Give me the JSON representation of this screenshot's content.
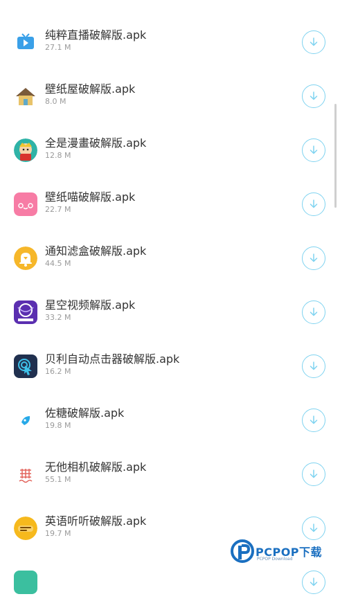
{
  "apps": [
    {
      "name": "纯粹直播破解版.apk",
      "size": "27.1 M",
      "icon": "tv-icon"
    },
    {
      "name": "壁纸屋破解版.apk",
      "size": "8.0 M",
      "icon": "house-icon"
    },
    {
      "name": "全是漫畫破解版.apk",
      "size": "12.8 M",
      "icon": "manga-icon"
    },
    {
      "name": "壁纸喵破解版.apk",
      "size": "22.7 M",
      "icon": "cat-face-icon"
    },
    {
      "name": "通知滤盒破解版.apk",
      "size": "44.5 M",
      "icon": "bell-icon"
    },
    {
      "name": "星空视频解版.apk",
      "size": "33.2 M",
      "icon": "starry-sky-icon"
    },
    {
      "name": "贝利自动点击器破解版.apk",
      "size": "16.2 M",
      "icon": "tap-icon"
    },
    {
      "name": "佐糖破解版.apk",
      "size": "19.8 M",
      "icon": "brush-icon"
    },
    {
      "name": "无他相机破解版.apk",
      "size": "55.1 M",
      "icon": "camera-grid-icon"
    },
    {
      "name": "英语听听破解版.apk",
      "size": "19.7 M",
      "icon": "english-icon"
    }
  ],
  "watermark": {
    "title": "PCPOP下载",
    "subtitle": "PCPOP Download"
  },
  "colors": {
    "accent": "#7fd3f0",
    "name_text": "#333333",
    "size_text": "#9a9a9a",
    "watermark": "#1a6fc0"
  }
}
